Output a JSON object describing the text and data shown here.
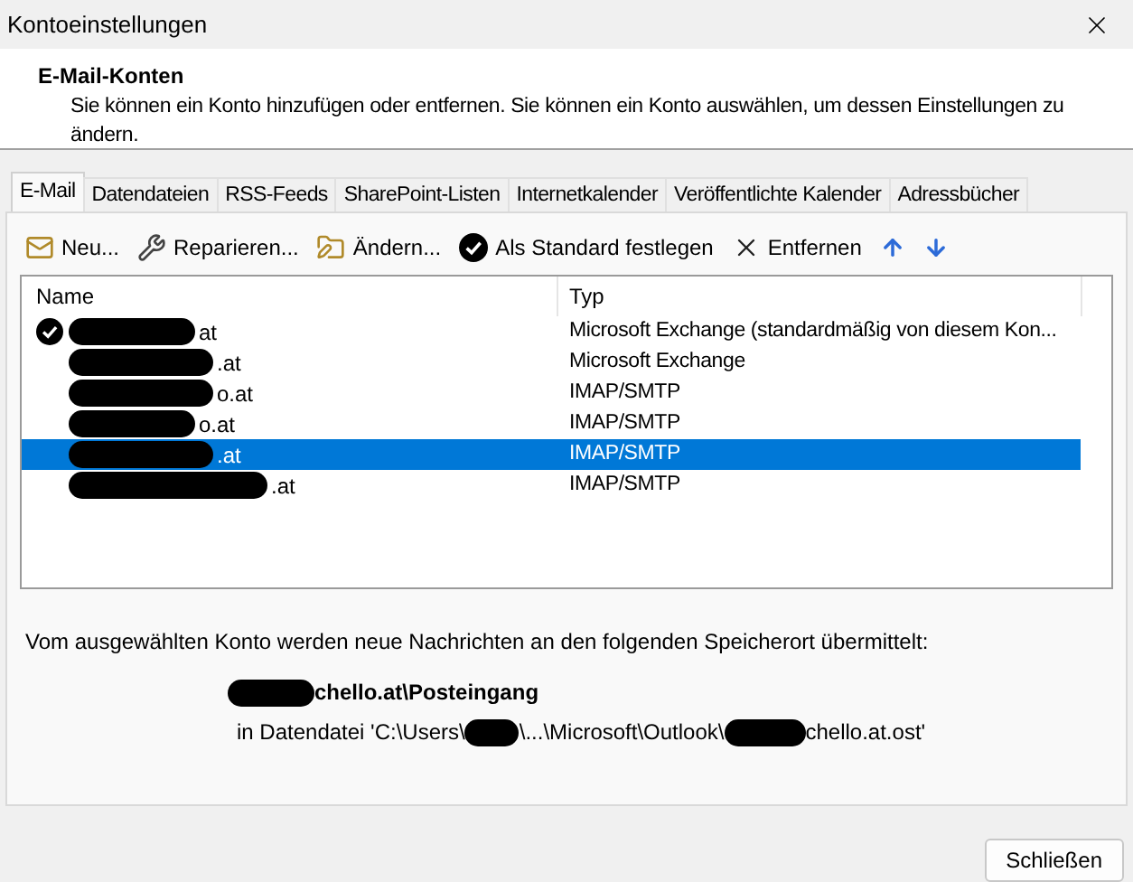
{
  "window": {
    "title": "Kontoeinstellungen"
  },
  "header": {
    "title": "E-Mail-Konten",
    "description": "Sie können ein Konto hinzufügen oder entfernen. Sie können ein Konto auswählen, um dessen Einstellungen zu ändern."
  },
  "tabs": [
    {
      "label": "E-Mail",
      "selected": true
    },
    {
      "label": "Datendateien",
      "selected": false
    },
    {
      "label": "RSS-Feeds",
      "selected": false
    },
    {
      "label": "SharePoint-Listen",
      "selected": false
    },
    {
      "label": "Internetkalender",
      "selected": false
    },
    {
      "label": "Veröffentlichte Kalender",
      "selected": false
    },
    {
      "label": "Adressbücher",
      "selected": false
    }
  ],
  "toolbar": [
    {
      "kind": "new",
      "label": "Neu..."
    },
    {
      "kind": "repair",
      "label": "Reparieren..."
    },
    {
      "kind": "change",
      "label": "Ändern..."
    },
    {
      "kind": "default",
      "label": "Als Standard festlegen"
    },
    {
      "kind": "remove",
      "label": "Entfernen"
    },
    {
      "kind": "up"
    },
    {
      "kind": "down"
    }
  ],
  "table": {
    "columns": [
      "Name",
      "Typ"
    ],
    "rows": [
      {
        "name": "at",
        "type": "Microsoft Exchange (standardmäßig von diesem Kon...",
        "default": true,
        "selected": false
      },
      {
        "name": ".at",
        "type": "Microsoft Exchange",
        "default": false,
        "selected": false
      },
      {
        "name": "o.at",
        "type": "IMAP/SMTP",
        "default": false,
        "selected": false
      },
      {
        "name": "o.at",
        "type": "IMAP/SMTP",
        "default": false,
        "selected": false
      },
      {
        "name": ".at",
        "type": "IMAP/SMTP",
        "default": false,
        "selected": true
      },
      {
        "name": ".at",
        "type": "IMAP/SMTP",
        "default": false,
        "selected": false
      }
    ]
  },
  "delivery": {
    "text": "Vom ausgewählten Konto werden neue Nachrichten an den folgenden Speicherort übermittelt:",
    "folder": "chello.at\\Posteingang",
    "path_parts": [
      "in Datendatei 'C:\\Users\\",
      "\\...\\Microsoft\\Outlook\\",
      "chello.at.ost'"
    ]
  },
  "buttons": [
    "Schließen"
  ]
}
